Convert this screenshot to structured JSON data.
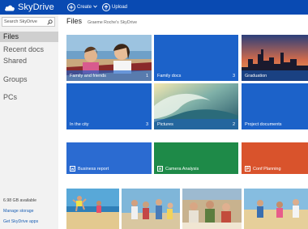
{
  "topbar": {
    "app_name": "SkyDrive",
    "create_label": "Create",
    "upload_label": "Upload",
    "brand_color": "#094ab2"
  },
  "sidebar": {
    "search_placeholder": "Search SkyDrive",
    "nav": [
      {
        "label": "Files",
        "active": true
      },
      {
        "label": "Recent docs"
      },
      {
        "label": "Shared"
      },
      {
        "label": "Groups"
      },
      {
        "label": "PCs"
      }
    ],
    "storage_available": "6.98 GB available",
    "manage_storage": "Manage storage",
    "get_apps": "Get SkyDrive apps"
  },
  "main": {
    "title": "Files",
    "breadcrumb": "Graeme Roche's SkyDrive",
    "folders": [
      {
        "name": "Family and friends",
        "count": "1",
        "kind": "photo-amusement"
      },
      {
        "name": "Family docs",
        "count": "3",
        "kind": "solid",
        "color": "#1c62c9"
      },
      {
        "name": "Graduation",
        "count": "",
        "kind": "photo-skyline"
      },
      {
        "name": "In the city",
        "count": "3",
        "kind": "solid",
        "color": "#1c62c9"
      },
      {
        "name": "Pictures",
        "count": "2",
        "kind": "photo-wave"
      },
      {
        "name": "Project documents",
        "count": "",
        "kind": "solid",
        "color": "#1c62c9"
      }
    ],
    "documents": [
      {
        "name": "Business report",
        "color": "#2b6bd1",
        "icon": "word-doc-icon"
      },
      {
        "name": "Camera Analysis",
        "color": "#1e8a48",
        "icon": "excel-doc-icon"
      },
      {
        "name": "Conf Planning",
        "color": "#d9532c",
        "icon": "powerpoint-doc-icon"
      }
    ],
    "photos": [
      {
        "subject": "beach-jumping"
      },
      {
        "subject": "family-group"
      },
      {
        "subject": "picnic-group"
      },
      {
        "subject": "beach-people"
      }
    ]
  }
}
